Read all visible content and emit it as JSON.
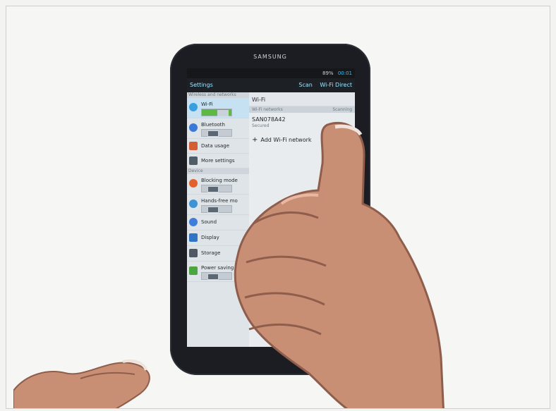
{
  "tablet": {
    "brand": "SAMSUNG",
    "status_percent": "89%",
    "status_time": "00:01"
  },
  "settings": {
    "title": "Settings",
    "actions": [
      "Scan",
      "Wi-Fi Direct"
    ],
    "left_section_top": "Wireless and networks",
    "left_items": [
      {
        "label": "Wi-Fi"
      },
      {
        "label": "Bluetooth"
      },
      {
        "label": "Data usage"
      },
      {
        "label": "More settings"
      }
    ],
    "left_section_bottom": "Device",
    "device_items": [
      {
        "label": "Blocking mode"
      },
      {
        "label": "Hands-free mo"
      },
      {
        "label": "Sound"
      },
      {
        "label": "Display"
      },
      {
        "label": "Storage"
      },
      {
        "label": "Power saving"
      }
    ],
    "right_title": "Wi-Fi",
    "right_section": "Wi-Fi networks",
    "right_section_status": "Scanning",
    "network_name": "SAN078A42",
    "network_status": "Secured",
    "add_network": "Add Wi-Fi network"
  },
  "colors": {
    "background": "#f3f3f1",
    "tablet": "#1b1d22",
    "screen": "#d9dde2",
    "accent": "#34c3ff",
    "wifi_highlight": "#c6e2f2",
    "toggle_on": "#5bb944",
    "skin": "#c88f74"
  }
}
